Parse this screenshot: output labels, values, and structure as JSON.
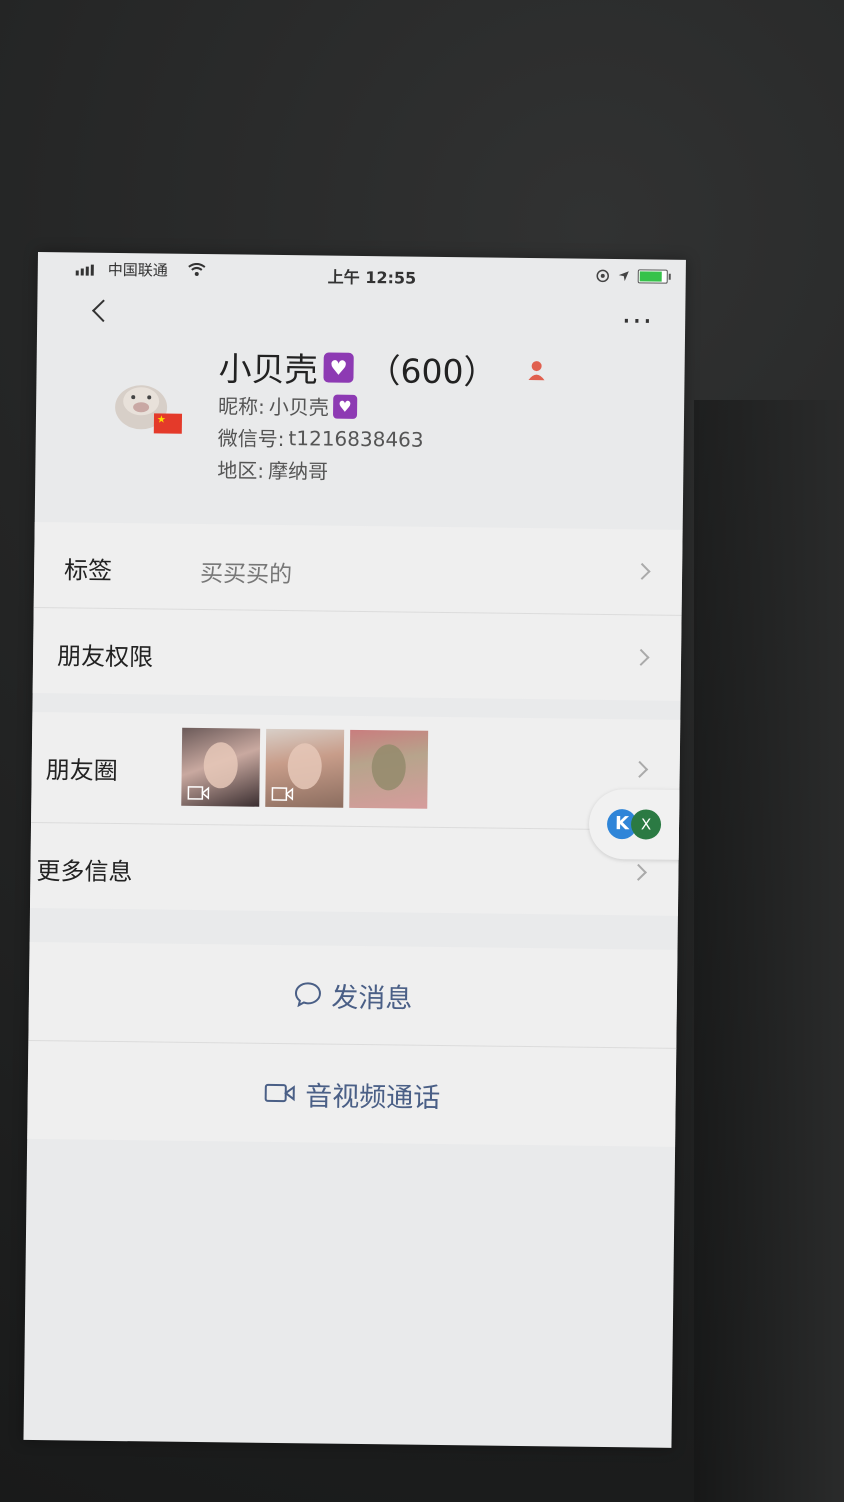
{
  "status_bar": {
    "carrier": "中国联通",
    "time": "上午 12:55"
  },
  "profile": {
    "name": "小贝壳",
    "count": "（600）",
    "nickname_label": "昵称:",
    "nickname": "小贝壳",
    "wechat_label": "微信号:",
    "wechat_id": "t1216838463",
    "region_label": "地区:",
    "region": "摩纳哥"
  },
  "rows": {
    "tags_label": "标签",
    "tags_value": "买买买的",
    "permissions_label": "朋友权限",
    "moments_label": "朋友圈",
    "more_info_label": "更多信息"
  },
  "actions": {
    "message": "发消息",
    "video_call": "音视频通话"
  },
  "icons": {
    "back": "chevron-left-icon",
    "more": "more-dots-icon",
    "heart": "heart-emoji-icon",
    "gender": "female-icon",
    "video": "video-icon",
    "chat": "chat-bubble-icon"
  },
  "colors": {
    "link": "#4a5f86",
    "heart_badge": "#8d3ab3",
    "flag": "#e43a2a"
  }
}
